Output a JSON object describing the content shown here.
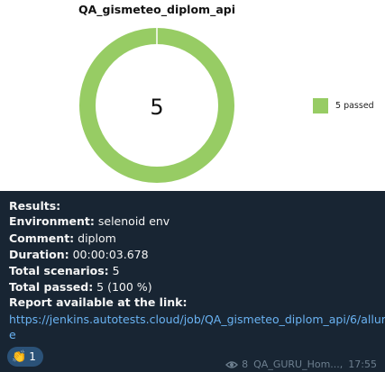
{
  "chart_data": {
    "type": "pie",
    "title": "QA_gismeteo_diplom_api",
    "center_label": "5",
    "slices": [
      {
        "label": "5 passed",
        "value": 5,
        "color": "#97cc64"
      }
    ],
    "legend_placement": "right"
  },
  "message": {
    "results_label": "Results:",
    "environment_label": "Environment:",
    "environment_value": " selenoid env",
    "comment_label": "Comment:",
    "comment_value": " diplom",
    "duration_label": "Duration:",
    "duration_value": " 00:00:03.678",
    "total_scenarios_label": "Total scenarios:",
    "total_scenarios_value": " 5",
    "total_passed_label": "Total passed:",
    "total_passed_value": " 5 (100 %)",
    "report_label": "Report available at the link:",
    "report_link_line1": "https://jenkins.autotests.cloud/job/QA_gismeteo_diplom_api/6/allur",
    "report_link_line2": "e"
  },
  "reaction": {
    "emoji": "👏",
    "count": "1"
  },
  "meta": {
    "eye_icon": "eye-icon",
    "views": "8",
    "channel": "QA_GURU_Hom...,",
    "time": "17:55"
  }
}
